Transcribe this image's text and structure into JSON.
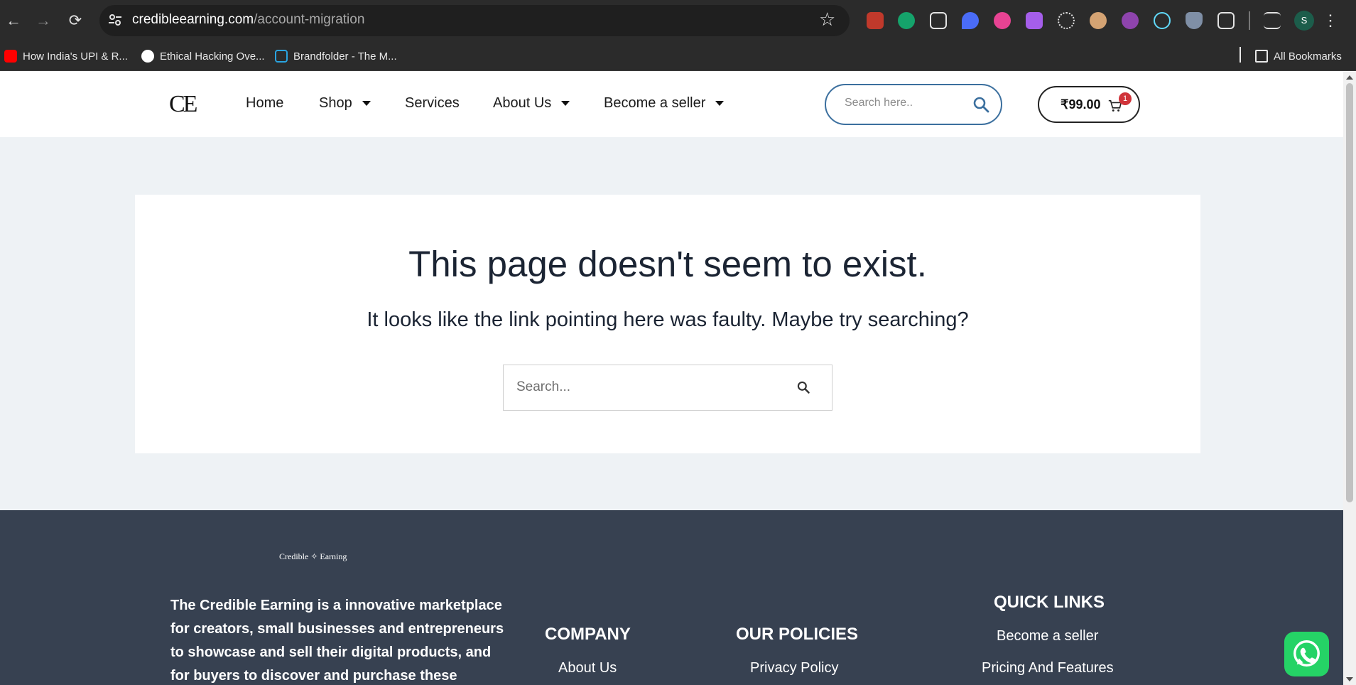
{
  "browser": {
    "url_domain": "credibleearning.com",
    "url_path": "/account-migration",
    "bookmarks": [
      {
        "label": "How India's UPI & R...",
        "color": "#ff0000"
      },
      {
        "label": "Ethical Hacking Ove...",
        "color": "#ffffff"
      },
      {
        "label": "Brandfolder - The M...",
        "color": "#2aa4e0"
      }
    ],
    "all_bookmarks": "All Bookmarks",
    "profile_initial": "S"
  },
  "header": {
    "logo": "CE",
    "menu": [
      "Home",
      "Shop",
      "Services",
      "About Us",
      "Become a seller"
    ],
    "search_placeholder": "Search here..",
    "cart_price": "₹99.00",
    "cart_count": "1"
  },
  "main": {
    "title": "This page doesn't seem to exist.",
    "subtitle": "It looks like the link pointing here was faulty. Maybe try searching?",
    "search_placeholder": "Search..."
  },
  "footer": {
    "logo": "Credible ✧ Earning",
    "description": "The Credible Earning is a innovative marketplace for creators, small businesses and entrepreneurs to showcase and sell their digital products, and for buyers to discover and purchase these",
    "company_heading": "COMPANY",
    "company_links": [
      "About Us"
    ],
    "policies_heading": "OUR POLICIES",
    "policies_links": [
      "Privacy Policy"
    ],
    "quick_heading": "QUICK LINKS",
    "quick_links": [
      "Become a seller",
      "Pricing And Features"
    ]
  },
  "colors": {
    "chrome_bg": "#2b2b2b",
    "page_bg": "#eef2f5",
    "footer_bg": "#374151",
    "search_border": "#3b6f9e",
    "badge": "#d0333a",
    "whatsapp": "#25d366"
  }
}
